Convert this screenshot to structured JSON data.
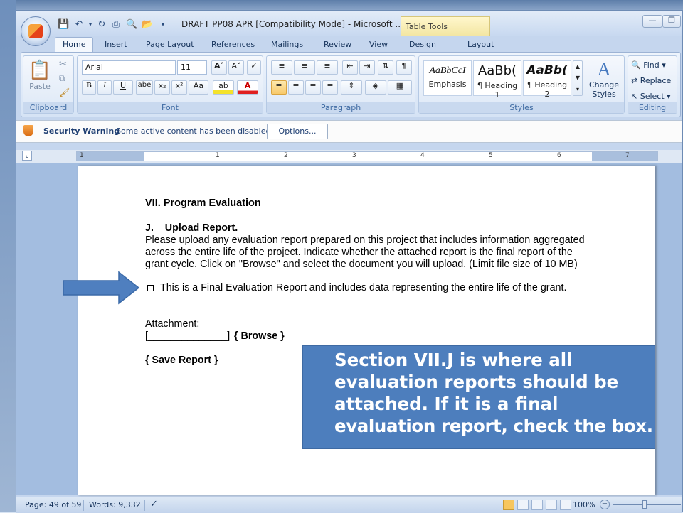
{
  "window": {
    "title": "DRAFT PP08 APR [Compatibility Mode] - Microsoft ...",
    "contextual_tab_group": "Table Tools"
  },
  "tabs": [
    "Home",
    "Insert",
    "Page Layout",
    "References",
    "Mailings",
    "Review",
    "View",
    "Design",
    "Layout"
  ],
  "active_tab": "Home",
  "ribbon": {
    "clipboard": {
      "label": "Clipboard",
      "paste": "Paste"
    },
    "font": {
      "label": "Font",
      "family": "Arial",
      "size": "11"
    },
    "paragraph": {
      "label": "Paragraph"
    },
    "styles": {
      "label": "Styles",
      "tiles": [
        {
          "sample": "AaBbCcI",
          "name": "Emphasis"
        },
        {
          "sample": "AaBb(",
          "name": "¶ Heading 1"
        },
        {
          "sample": "AaBb(",
          "name": "¶ Heading 2"
        }
      ],
      "change_styles": "Change Styles"
    },
    "editing": {
      "label": "Editing",
      "find": "Find",
      "replace": "Replace",
      "select": "Select"
    }
  },
  "security_bar": {
    "title": "Security Warning",
    "message": "Some active content has been disabled.",
    "button": "Options..."
  },
  "ruler": {
    "numbers": [
      "1",
      "1",
      "2",
      "3",
      "4",
      "5",
      "6",
      "7"
    ]
  },
  "document": {
    "heading": "VII. Program Evaluation",
    "section_title": "J.    Upload Report.",
    "paragraph_lines": [
      "Please upload any evaluation report prepared on this project that includes information aggregated",
      "across the entire life of the project. Indicate whether the attached report is the final report of the",
      "grant cycle. Click on \"Browse\" and select the document you will upload. (Limit file size of 10 MB)"
    ],
    "checkbox_label": "This is a Final Evaluation Report and includes data representing the entire life of the grant.",
    "attachment_label": "Attachment:",
    "attachment_field": "[______________]",
    "browse": "{ Browse }",
    "save_report": "{ Save Report }"
  },
  "callout": {
    "lines": [
      "Section VII.J is where all",
      "evaluation reports should be",
      "attached. If it is a final",
      "evaluation report, check the box."
    ]
  },
  "status_bar": {
    "page": "Page: 49 of 59",
    "words": "Words: 9,332",
    "zoom": "100%"
  },
  "colors": {
    "callout_bg": "#4d7ebd",
    "arrow": "#4f7fbf",
    "ribbon_bg": "#dbe7f6"
  }
}
